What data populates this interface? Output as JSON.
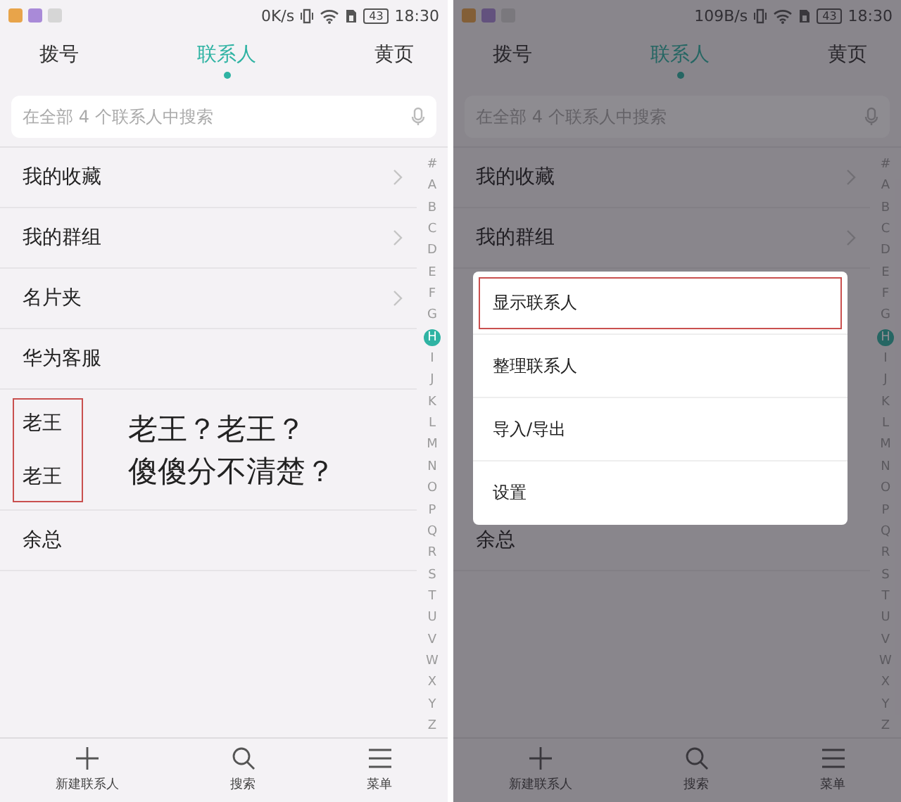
{
  "panels": [
    {
      "status_bar": {
        "speed": "0K/s",
        "battery": "43",
        "time": "18:30"
      },
      "tabs": [
        {
          "label": "拨号",
          "selected": false
        },
        {
          "label": "联系人",
          "selected": true
        },
        {
          "label": "黄页",
          "selected": false
        }
      ],
      "search": {
        "placeholder": "在全部 4 个联系人中搜索"
      },
      "contacts": [
        {
          "kind": "contact",
          "name": "我的收藏",
          "chevron": true
        },
        {
          "kind": "contact",
          "name": "我的群组",
          "chevron": true
        },
        {
          "kind": "contact",
          "name": "名片夹",
          "chevron": true
        },
        {
          "kind": "contact",
          "name": "华为客服",
          "chevron": false
        },
        {
          "kind": "callout",
          "names": [
            "老王",
            "老王"
          ],
          "note": [
            "老王？老王？",
            "傻傻分不清楚？"
          ]
        },
        {
          "kind": "contact",
          "name": "余总",
          "chevron": false
        }
      ],
      "index": [
        {
          "label": "#",
          "selected": false
        },
        {
          "label": "A",
          "selected": false
        },
        {
          "label": "B",
          "selected": false
        },
        {
          "label": "C",
          "selected": false
        },
        {
          "label": "D",
          "selected": false
        },
        {
          "label": "E",
          "selected": false
        },
        {
          "label": "F",
          "selected": false
        },
        {
          "label": "G",
          "selected": false
        },
        {
          "label": "H",
          "selected": true
        },
        {
          "label": "I",
          "selected": false
        },
        {
          "label": "J",
          "selected": false
        },
        {
          "label": "K",
          "selected": false
        },
        {
          "label": "L",
          "selected": false
        },
        {
          "label": "M",
          "selected": false
        },
        {
          "label": "N",
          "selected": false
        },
        {
          "label": "O",
          "selected": false
        },
        {
          "label": "P",
          "selected": false
        },
        {
          "label": "Q",
          "selected": false
        },
        {
          "label": "R",
          "selected": false
        },
        {
          "label": "S",
          "selected": false
        },
        {
          "label": "T",
          "selected": false
        },
        {
          "label": "U",
          "selected": false
        },
        {
          "label": "V",
          "selected": false
        },
        {
          "label": "W",
          "selected": false
        },
        {
          "label": "X",
          "selected": false
        },
        {
          "label": "Y",
          "selected": false
        },
        {
          "label": "Z",
          "selected": false
        }
      ],
      "toolbar": [
        {
          "kind": "add",
          "label": "新建联系人"
        },
        {
          "kind": "search",
          "label": "搜索"
        },
        {
          "kind": "menu",
          "label": "菜单"
        }
      ],
      "dimmed": false
    },
    {
      "status_bar": {
        "speed": "109B/s",
        "battery": "43",
        "time": "18:30"
      },
      "tabs": [
        {
          "label": "拨号",
          "selected": false
        },
        {
          "label": "联系人",
          "selected": true
        },
        {
          "label": "黄页",
          "selected": false
        }
      ],
      "search": {
        "placeholder": "在全部 4 个联系人中搜索"
      },
      "contacts": [
        {
          "kind": "contact",
          "name": "我的收藏",
          "chevron": true
        },
        {
          "kind": "contact",
          "name": "我的群组",
          "chevron": true
        },
        {
          "kind": "menu",
          "items": [
            {
              "label": "显示联系人",
              "outlined": true
            },
            {
              "label": "整理联系人",
              "outlined": false
            },
            {
              "label": "导入/导出",
              "outlined": false
            },
            {
              "label": "设置",
              "outlined": false
            }
          ]
        },
        {
          "kind": "contact",
          "name": "余总",
          "chevron": false
        }
      ],
      "index": [
        {
          "label": "#",
          "selected": false
        },
        {
          "label": "A",
          "selected": false
        },
        {
          "label": "B",
          "selected": false
        },
        {
          "label": "C",
          "selected": false
        },
        {
          "label": "D",
          "selected": false
        },
        {
          "label": "E",
          "selected": false
        },
        {
          "label": "F",
          "selected": false
        },
        {
          "label": "G",
          "selected": false
        },
        {
          "label": "H",
          "selected": true
        },
        {
          "label": "I",
          "selected": false
        },
        {
          "label": "J",
          "selected": false
        },
        {
          "label": "K",
          "selected": false
        },
        {
          "label": "L",
          "selected": false
        },
        {
          "label": "M",
          "selected": false
        },
        {
          "label": "N",
          "selected": false
        },
        {
          "label": "O",
          "selected": false
        },
        {
          "label": "P",
          "selected": false
        },
        {
          "label": "Q",
          "selected": false
        },
        {
          "label": "R",
          "selected": false
        },
        {
          "label": "S",
          "selected": false
        },
        {
          "label": "T",
          "selected": false
        },
        {
          "label": "U",
          "selected": false
        },
        {
          "label": "V",
          "selected": false
        },
        {
          "label": "W",
          "selected": false
        },
        {
          "label": "X",
          "selected": false
        },
        {
          "label": "Y",
          "selected": false
        },
        {
          "label": "Z",
          "selected": false
        }
      ],
      "toolbar": [
        {
          "kind": "add",
          "label": "新建联系人"
        },
        {
          "kind": "search",
          "label": "搜索"
        },
        {
          "kind": "menu",
          "label": "菜单"
        }
      ],
      "dimmed": true
    }
  ]
}
